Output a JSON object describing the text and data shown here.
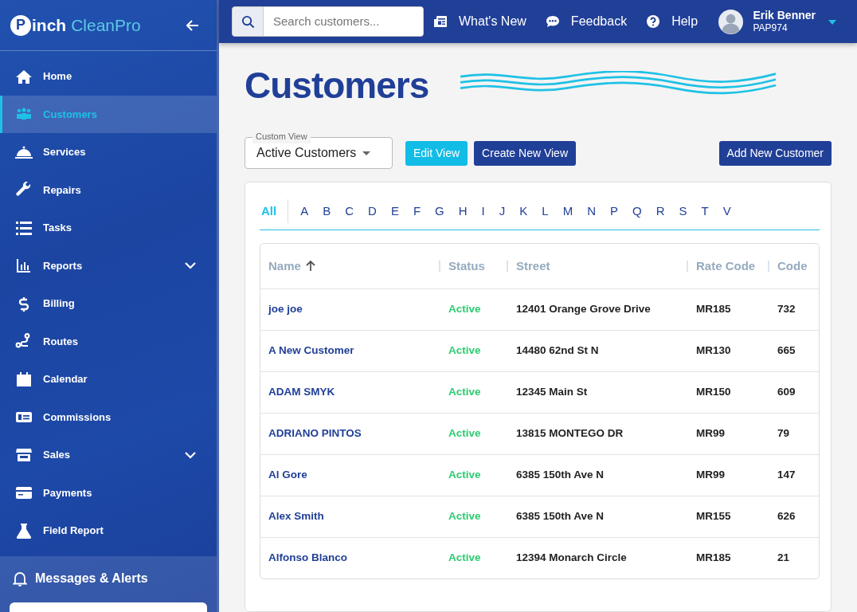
{
  "sidebar": {
    "logo": {
      "first": "inch",
      "second": "CleanPro",
      "initial": "P"
    },
    "items": [
      {
        "label": "Home",
        "selected": false,
        "has_submenu": false
      },
      {
        "label": "Customers",
        "selected": true,
        "has_submenu": false
      },
      {
        "label": "Services",
        "selected": false,
        "has_submenu": false
      },
      {
        "label": "Repairs",
        "selected": false,
        "has_submenu": false
      },
      {
        "label": "Tasks",
        "selected": false,
        "has_submenu": false
      },
      {
        "label": "Reports",
        "selected": false,
        "has_submenu": true
      },
      {
        "label": "Billing",
        "selected": false,
        "has_submenu": false
      },
      {
        "label": "Routes",
        "selected": false,
        "has_submenu": false
      },
      {
        "label": "Calendar",
        "selected": false,
        "has_submenu": false
      },
      {
        "label": "Commissions",
        "selected": false,
        "has_submenu": false
      },
      {
        "label": "Sales",
        "selected": false,
        "has_submenu": true
      },
      {
        "label": "Payments",
        "selected": false,
        "has_submenu": false
      },
      {
        "label": "Field Report",
        "selected": false,
        "has_submenu": false
      }
    ],
    "alerts_title": "Messages & Alerts"
  },
  "topbar": {
    "search": {
      "placeholder": "Search customers..."
    },
    "links": [
      "What's New",
      "Feedback",
      "Help"
    ],
    "user": {
      "name": "Erik Benner",
      "code": "PAP974"
    }
  },
  "page": {
    "title": "Customers",
    "custom_view": {
      "label": "Custom View",
      "value": "Active Customers"
    },
    "buttons": {
      "edit": "Edit View",
      "create": "Create New View",
      "add": "Add New Customer"
    }
  },
  "letters": [
    {
      "label": "All",
      "selected": true
    },
    {
      "label": "A",
      "selected": false
    },
    {
      "label": "B",
      "selected": false
    },
    {
      "label": "C",
      "selected": false
    },
    {
      "label": "D",
      "selected": false
    },
    {
      "label": "E",
      "selected": false
    },
    {
      "label": "F",
      "selected": false
    },
    {
      "label": "G",
      "selected": false
    },
    {
      "label": "H",
      "selected": false
    },
    {
      "label": "I",
      "selected": false
    },
    {
      "label": "J",
      "selected": false
    },
    {
      "label": "K",
      "selected": false
    },
    {
      "label": "L",
      "selected": false
    },
    {
      "label": "M",
      "selected": false
    },
    {
      "label": "N",
      "selected": false
    },
    {
      "label": "P",
      "selected": false
    },
    {
      "label": "Q",
      "selected": false
    },
    {
      "label": "R",
      "selected": false
    },
    {
      "label": "S",
      "selected": false
    },
    {
      "label": "T",
      "selected": false
    },
    {
      "label": "V",
      "selected": false
    }
  ],
  "table": {
    "columns": [
      {
        "label": "Name",
        "sorted": true
      },
      {
        "label": "Status",
        "sorted": false
      },
      {
        "label": "Street",
        "sorted": false
      },
      {
        "label": "Rate Code",
        "sorted": false
      },
      {
        "label": "Code",
        "sorted": false
      }
    ],
    "rows": [
      [
        "joe joe",
        "Active",
        "12401 Orange Grove Drive",
        "MR185",
        "732"
      ],
      [
        "A New Customer",
        "Active",
        "14480 62nd St N",
        "MR130",
        "665"
      ],
      [
        "ADAM SMYK",
        "Active",
        "12345 Main St",
        "MR150",
        "609"
      ],
      [
        "ADRIANO PINTOS",
        "Active",
        "13815 MONTEGO DR",
        "MR99",
        "79"
      ],
      [
        "Al Gore",
        "Active",
        "6385 150th Ave N",
        "MR99",
        "147"
      ],
      [
        "Alex Smith",
        "Active",
        "6385 150th Ave N",
        "MR155",
        "626"
      ],
      [
        "Alfonso Blanco",
        "Active",
        "12394 Monarch Circle",
        "MR185",
        "21"
      ]
    ]
  }
}
